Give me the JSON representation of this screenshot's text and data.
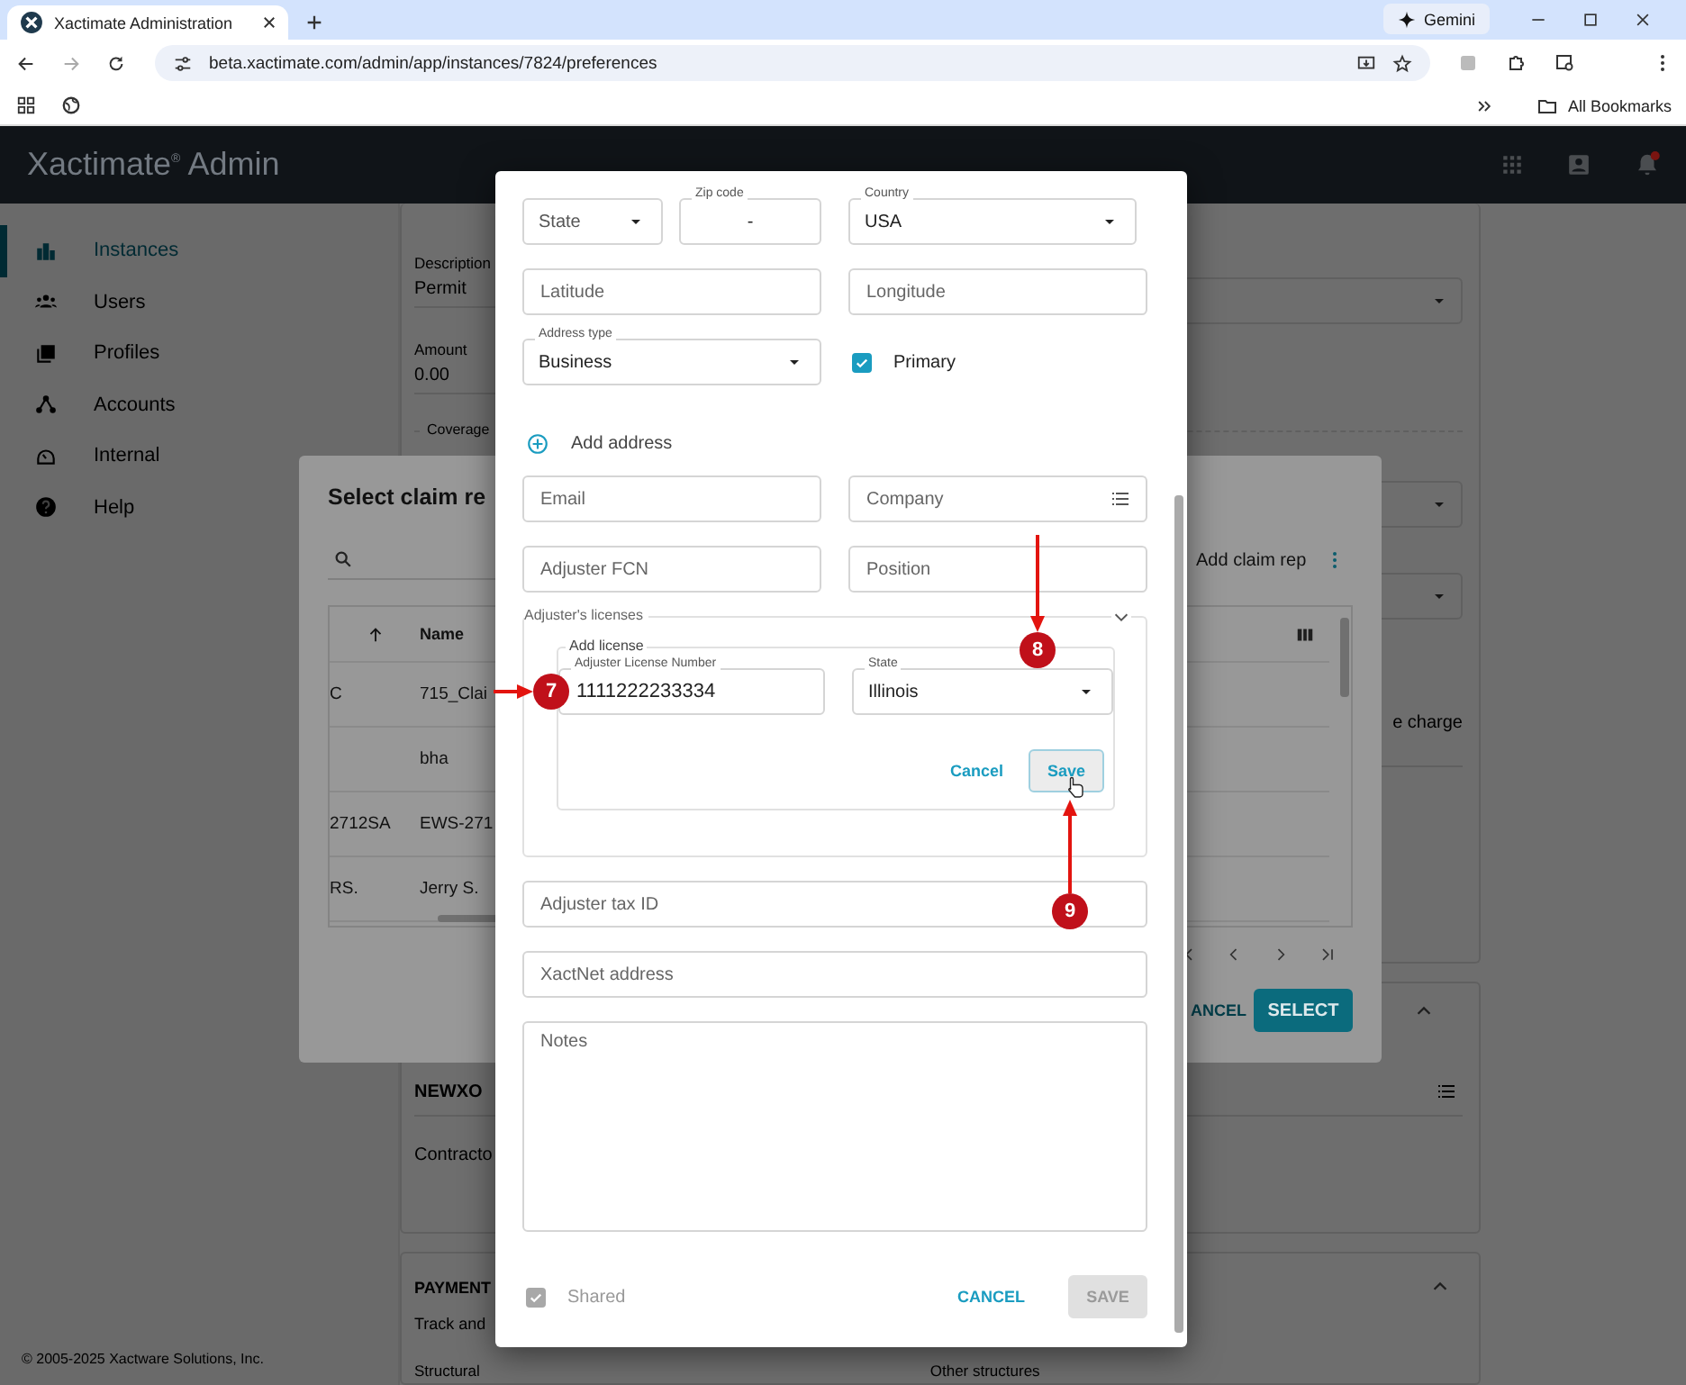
{
  "browser": {
    "tab_title": "Xactimate Administration",
    "gemini": "Gemini",
    "url": "beta.xactimate.com/admin/app/instances/7824/preferences",
    "bookmarks": "All Bookmarks"
  },
  "app": {
    "brand": "Xactimate$^{®}$ Admin",
    "notification": true,
    "sidebar": [
      {
        "label": "Instances",
        "selected": true
      },
      {
        "label": "Users",
        "selected": false
      },
      {
        "label": "Profiles",
        "selected": false
      },
      {
        "label": "Accounts",
        "selected": false
      },
      {
        "label": "Internal",
        "selected": false
      },
      {
        "label": "Help",
        "selected": false
      }
    ],
    "copyright": "© 2005-2025 Xactware Solutions, Inc."
  },
  "page": {
    "fields": [
      {
        "label": "Description",
        "value": "Permit"
      },
      {
        "label": "Amount",
        "value": "0.00"
      }
    ],
    "coverage_label": "Coverage",
    "coverage_text": "e charge",
    "contractor": {
      "value": "NEWXO",
      "label": "Contracto"
    },
    "payment": {
      "title": "PAYMENT",
      "subtitle": "Track and",
      "labels": [
        "Structural",
        "Other structures"
      ]
    }
  },
  "claim_rep_dialog": {
    "title": "Select claim re",
    "add_label": "Add claim rep",
    "columns": [
      {
        "sorted": true
      },
      {
        "label": "Name",
        "sorted": false
      }
    ],
    "rows": [
      {
        "column_1": "C",
        "name": "715_Clai"
      },
      {
        "name": "bha"
      },
      {
        "column_1": "2712SA",
        "name": "EWS-271"
      },
      {
        "column_1": "RS.",
        "name": "Jerry S."
      }
    ],
    "cancel": "ANCEL",
    "select": "SELECT"
  },
  "contact_dialog": {
    "rows": [
      [
        {
          "kind": "select",
          "placeholder": "State"
        },
        {
          "kind": "text",
          "label": "Zip code",
          "value": "-"
        },
        {
          "kind": "select",
          "label": "Country",
          "value": "USA"
        }
      ],
      [
        {
          "kind": "text",
          "placeholder": "Latitude"
        },
        {
          "kind": "text",
          "placeholder": "Longitude"
        }
      ],
      [
        {
          "kind": "select",
          "label": "Address type",
          "value": "Business"
        },
        {
          "kind": "checkbox",
          "label": "Primary",
          "checked": true,
          "disabled": false
        }
      ],
      [
        {
          "kind": "action",
          "label": "Add address"
        }
      ],
      [
        {
          "kind": "text",
          "placeholder": "Email"
        },
        {
          "kind": "picker",
          "placeholder": "Company"
        }
      ],
      [
        {
          "kind": "text",
          "placeholder": "Adjuster FCN"
        },
        {
          "kind": "text",
          "placeholder": "Position"
        }
      ]
    ],
    "licenses": {
      "title": "Adjuster's licenses",
      "expanded": true,
      "add_title": "Add license",
      "fields": [
        {
          "kind": "text",
          "label": "Adjuster License Number",
          "value": "1111222233334"
        },
        {
          "kind": "select",
          "label": "State",
          "value": "Illinois"
        }
      ],
      "cancel": "Cancel",
      "save": "Save",
      "save_hovered": true
    },
    "more_rows": [
      [
        {
          "kind": "text",
          "placeholder": "Adjuster tax ID"
        }
      ],
      [
        {
          "kind": "text",
          "placeholder": "XactNet address"
        }
      ],
      [
        {
          "kind": "textarea",
          "placeholder": "Notes"
        }
      ]
    ],
    "shared": {
      "label": "Shared",
      "checked": true,
      "disabled": true
    },
    "cancel": "CANCEL",
    "save": {
      "label": "SAVE",
      "disabled": true
    }
  },
  "annotations": [
    {
      "number": "7"
    },
    {
      "number": "8"
    },
    {
      "number": "9"
    }
  ]
}
